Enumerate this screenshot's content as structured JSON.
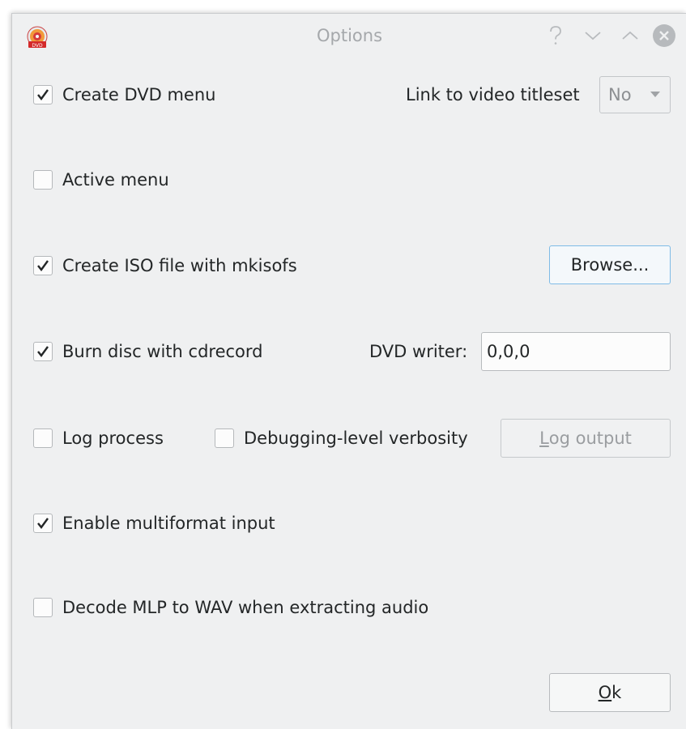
{
  "window": {
    "title": "Options",
    "app_icon_text": "DVD"
  },
  "options": {
    "create_dvd_menu": {
      "label": "Create DVD menu",
      "checked": true
    },
    "link_label": "Link to video titleset",
    "titleset_value": "No",
    "active_menu": {
      "label": "Active menu",
      "checked": false
    },
    "create_iso": {
      "label": "Create ISO file with mkisofs",
      "checked": true
    },
    "browse_label": "Browse...",
    "burn_disc": {
      "label": "Burn disc with cdrecord",
      "checked": true
    },
    "dvd_writer_label": "DVD writer:",
    "dvd_writer_value": "0,0,0",
    "log_process": {
      "label": "Log process",
      "checked": false
    },
    "debug_verbosity": {
      "label": "Debugging-level verbosity",
      "checked": false
    },
    "log_output": {
      "mnemonic": "L",
      "rest": "og output"
    },
    "multiformat": {
      "label": "Enable multiformat input",
      "checked": true
    },
    "decode_mlp": {
      "label": "Decode MLP to WAV when extracting audio",
      "checked": false
    }
  },
  "ok": {
    "mnemonic": "O",
    "rest": "k"
  },
  "colors": {
    "window_bg": "#eff0f1",
    "focus_border": "#7fbbe6",
    "text": "#232627",
    "disabled_text": "#9a9da0"
  },
  "icons": {
    "help": "question-mark-icon",
    "minimize": "chevron-down-icon",
    "maximize": "chevron-up-icon",
    "close": "close-circle-icon",
    "check": "checkmark-icon"
  }
}
